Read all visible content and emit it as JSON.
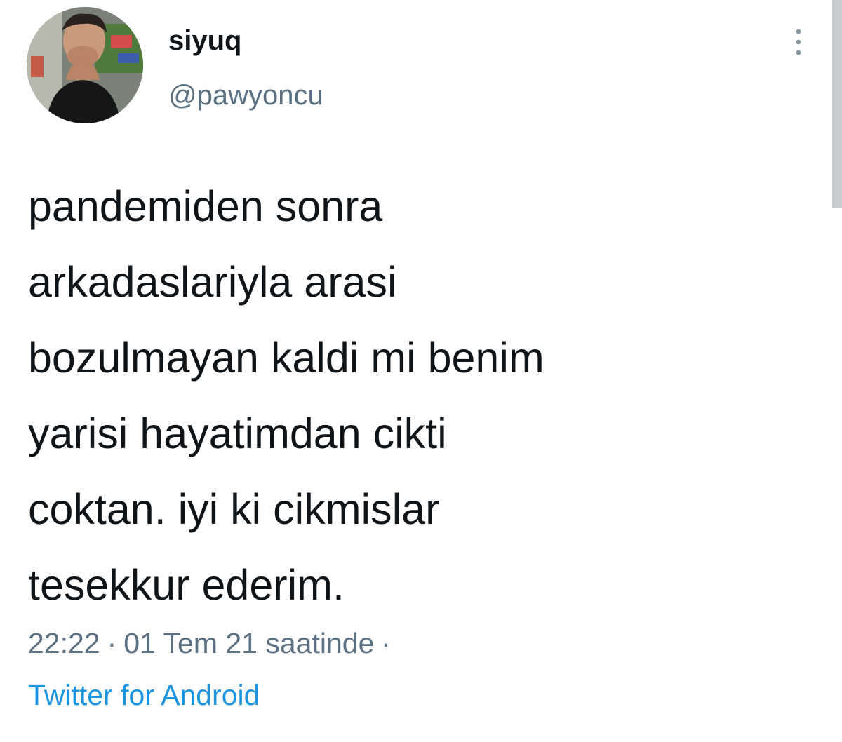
{
  "user": {
    "display_name": "siyuq",
    "handle": "@pawyoncu",
    "avatar_icon": "user-photo"
  },
  "tweet": {
    "lines": [
      "pandemiden sonra",
      "arkadaslariyla arasi",
      "bozulmayan kaldi mi benim",
      "yarisi hayatimdan cikti",
      "coktan. iyi ki cikmislar",
      "tesekkur ederim."
    ],
    "time": "22:22",
    "date": "01 Tem 21 saatinde",
    "separator": "·",
    "source": "Twitter for Android"
  },
  "icons": {
    "more": "more-vertical-icon"
  },
  "colors": {
    "text": "#0f1419",
    "secondary": "#5b7083",
    "link": "#1b95e0"
  }
}
